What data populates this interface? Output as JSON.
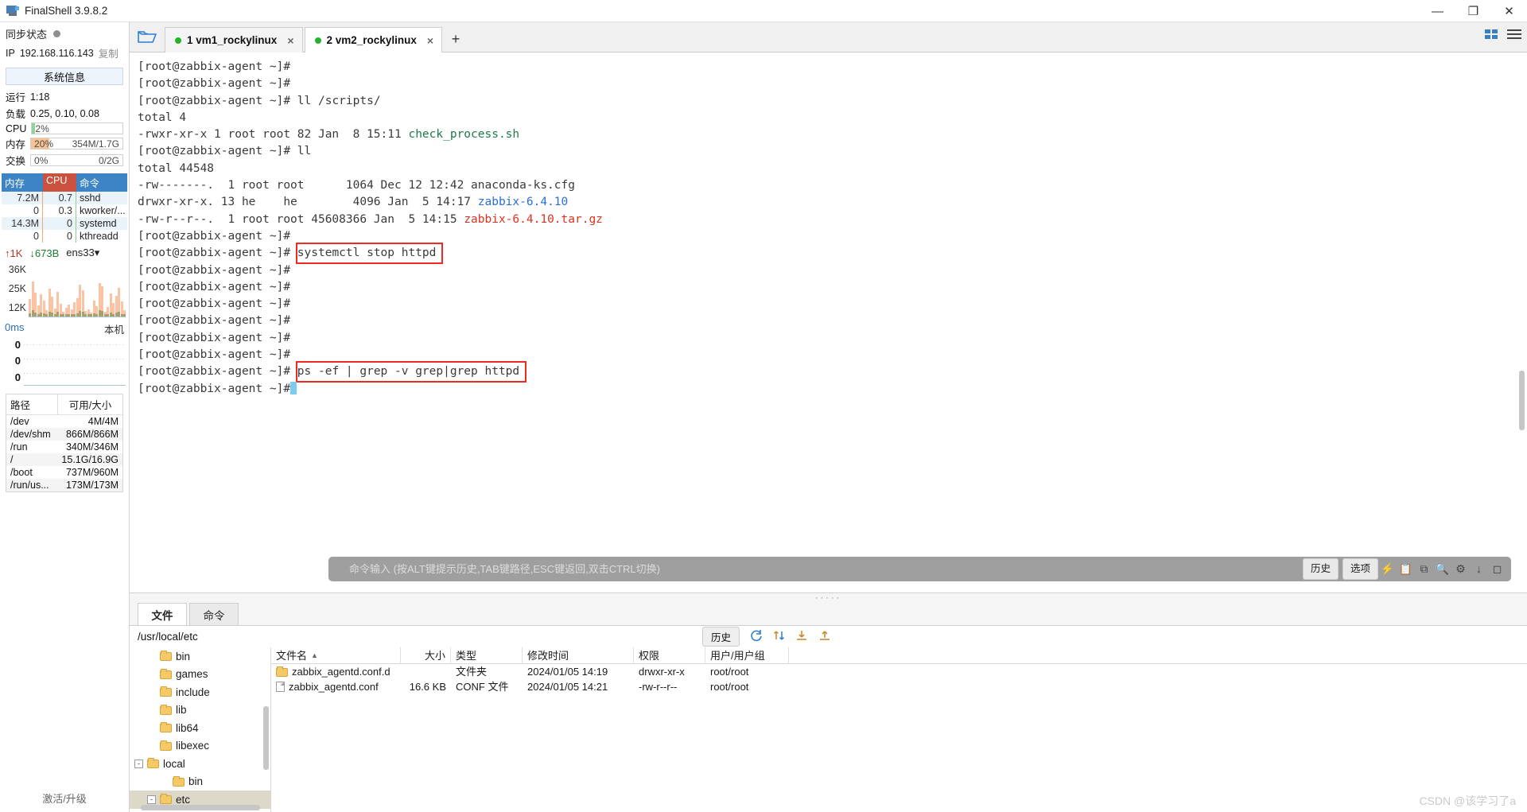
{
  "window": {
    "title": "FinalShell 3.9.8.2",
    "minimize": "—",
    "maximize": "❐",
    "close": "✕"
  },
  "sidebar": {
    "sync_label": "同步状态",
    "ip_label": "IP",
    "ip_value": "192.168.116.143",
    "copy_label": "复制",
    "sysinfo_button": "系统信息",
    "uptime_label": "运行",
    "uptime_value": "1:18",
    "load_label": "负载",
    "load_value": "0.25, 0.10, 0.08",
    "cpu_label": "CPU",
    "cpu_pct": "2%",
    "cpu_fill_color": "#8fd39a",
    "mem_label": "内存",
    "mem_pct": "20%",
    "mem_detail": "354M/1.7G",
    "mem_fill_color": "#f7c395",
    "swap_label": "交换",
    "swap_pct": "0%",
    "swap_detail": "0/2G",
    "proc_headers": [
      "内存",
      "CPU",
      "命令"
    ],
    "proc_rows": [
      {
        "mem": "7.2M",
        "cpu": "0.7",
        "cmd": "sshd"
      },
      {
        "mem": "0",
        "cpu": "0.3",
        "cmd": "kworker/..."
      },
      {
        "mem": "14.3M",
        "cpu": "0",
        "cmd": "systemd"
      },
      {
        "mem": "0",
        "cpu": "0",
        "cmd": "kthreadd"
      }
    ],
    "net": {
      "up": "1K",
      "down": "673B",
      "interface": "ens33",
      "y_ticks": [
        "36K",
        "25K",
        "12K"
      ]
    },
    "latency": {
      "value": "0ms",
      "host": "本机",
      "y_ticks": [
        "0",
        "0",
        "0"
      ]
    },
    "disk_headers": [
      "路径",
      "可用/大小"
    ],
    "disk_rows": [
      {
        "path": "/dev",
        "size": "4M/4M"
      },
      {
        "path": "/dev/shm",
        "size": "866M/866M"
      },
      {
        "path": "/run",
        "size": "340M/346M"
      },
      {
        "path": "/",
        "size": "15.1G/16.9G"
      },
      {
        "path": "/boot",
        "size": "737M/960M"
      },
      {
        "path": "/run/us...",
        "size": "173M/173M"
      }
    ],
    "activate_label": "激活/升级"
  },
  "tabs": {
    "folder_icon": "folder-open-icon",
    "items": [
      {
        "label": "1 vm1_rockylinux",
        "active": false
      },
      {
        "label": "2 vm2_rockylinux",
        "active": true
      }
    ],
    "add_label": "+",
    "grid_icon": "grid-view-icon",
    "list_icon": "list-view-icon"
  },
  "terminal": {
    "prompt": "[root@zabbix-agent ~]#",
    "lines": [
      {
        "prompt": true,
        "cmd": ""
      },
      {
        "prompt": true,
        "cmd": ""
      },
      {
        "prompt": true,
        "cmd": " ll /scripts/"
      },
      {
        "prompt": false,
        "text": "total 4"
      },
      {
        "prompt": false,
        "text": "-rwxr-xr-x 1 root root 82 Jan  8 15:11 ",
        "green": "check_process.sh"
      },
      {
        "prompt": true,
        "cmd": " ll"
      },
      {
        "prompt": false,
        "text": "total 44548"
      },
      {
        "prompt": false,
        "text": "-rw-------.  1 root root      1064 Dec 12 12:42 anaconda-ks.cfg"
      },
      {
        "prompt": false,
        "text": "drwxr-xr-x. 13 he    he        4096 Jan  5 14:17 ",
        "blue": "zabbix-6.4.10"
      },
      {
        "prompt": false,
        "text": "-rw-r--r--.  1 root root 45608366 Jan  5 14:15 ",
        "red": "zabbix-6.4.10.tar.gz"
      },
      {
        "prompt": true,
        "cmd": ""
      },
      {
        "prompt": true,
        "cmd": " systemctl stop httpd",
        "boxed": true
      },
      {
        "prompt": true,
        "cmd": ""
      },
      {
        "prompt": true,
        "cmd": ""
      },
      {
        "prompt": true,
        "cmd": ""
      },
      {
        "prompt": true,
        "cmd": ""
      },
      {
        "prompt": true,
        "cmd": ""
      },
      {
        "prompt": true,
        "cmd": ""
      },
      {
        "prompt": true,
        "cmd": " ps -ef | grep -v grep|grep httpd",
        "boxed": true
      },
      {
        "prompt": true,
        "cmd": "",
        "cursor": true
      }
    ]
  },
  "command_bar": {
    "placeholder": "命令输入 (按ALT键提示历史,TAB键路径,ESC键返回,双击CTRL切换)",
    "history_label": "历史",
    "options_label": "选项",
    "icons": [
      "bolt-icon",
      "copy-icon",
      "clipboard-icon",
      "search-icon",
      "gear-icon",
      "download-icon",
      "window-icon"
    ]
  },
  "dock": {
    "tabs": [
      {
        "label": "文件",
        "active": true
      },
      {
        "label": "命令",
        "active": false
      }
    ],
    "path": "/usr/local/etc",
    "history_label": "历史",
    "toolbar_icons": [
      "refresh-icon",
      "upload-download-icon",
      "download-icon",
      "upload-icon"
    ],
    "tree": [
      {
        "label": "bin",
        "depth": 1,
        "expandable": false,
        "selected": false
      },
      {
        "label": "games",
        "depth": 1,
        "expandable": false,
        "selected": false
      },
      {
        "label": "include",
        "depth": 1,
        "expandable": false,
        "selected": false
      },
      {
        "label": "lib",
        "depth": 1,
        "expandable": false,
        "selected": false
      },
      {
        "label": "lib64",
        "depth": 1,
        "expandable": false,
        "selected": false
      },
      {
        "label": "libexec",
        "depth": 1,
        "expandable": false,
        "selected": false
      },
      {
        "label": "local",
        "depth": 0,
        "expandable": true,
        "twisty": "-",
        "selected": false
      },
      {
        "label": "bin",
        "depth": 2,
        "expandable": false,
        "selected": false
      },
      {
        "label": "etc",
        "depth": 1,
        "expandable": true,
        "twisty": "-",
        "selected": true
      }
    ],
    "file_headers": [
      "文件名",
      "大小",
      "类型",
      "修改时间",
      "权限",
      "用户/用户组"
    ],
    "sort_indicator": "▲",
    "files": [
      {
        "name": "zabbix_agentd.conf.d",
        "size": "",
        "type": "文件夹",
        "mtime": "2024/01/05 14:19",
        "perm": "drwxr-xr-x",
        "owner": "root/root",
        "is_folder": true
      },
      {
        "name": "zabbix_agentd.conf",
        "size": "16.6 KB",
        "type": "CONF 文件",
        "mtime": "2024/01/05 14:21",
        "perm": "-rw-r--r--",
        "owner": "root/root",
        "is_folder": false
      }
    ]
  },
  "watermark": "CSDN @该学习了a"
}
